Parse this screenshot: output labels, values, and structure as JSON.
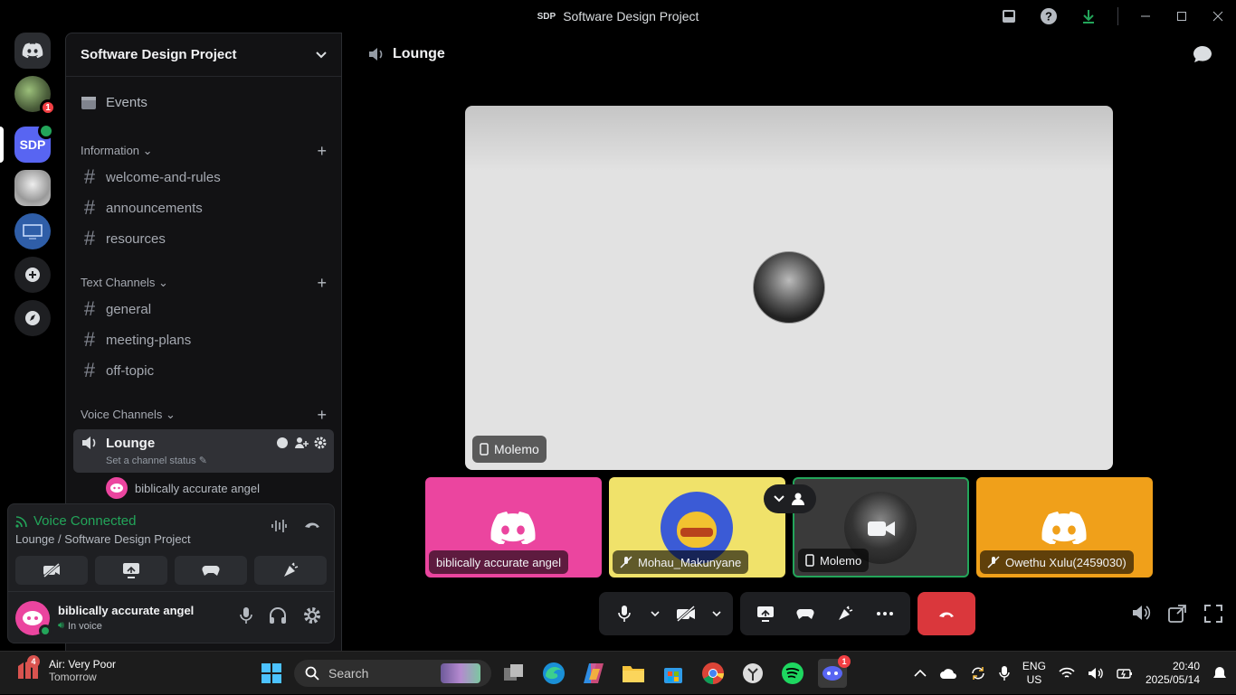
{
  "window": {
    "title": "Software Design Project",
    "badge": "SDP"
  },
  "servers": [
    {
      "name": "dm-home",
      "badge": ""
    },
    {
      "name": "server-1",
      "badge": "1"
    },
    {
      "name": "server-sdp",
      "label": "SDP"
    },
    {
      "name": "server-3"
    },
    {
      "name": "server-4"
    }
  ],
  "guild": {
    "name": "Software Design Project",
    "events_label": "Events",
    "categories": [
      {
        "label": "Information",
        "channels": [
          "welcome-and-rules",
          "announcements",
          "resources"
        ]
      },
      {
        "label": "Text Channels",
        "channels": [
          "general",
          "meeting-plans",
          "off-topic"
        ]
      },
      {
        "label": "Voice Channels"
      }
    ],
    "voice_channel": {
      "name": "Lounge",
      "status_placeholder": "Set a channel status",
      "members": [
        "biblically accurate angel"
      ]
    }
  },
  "voice_panel": {
    "status": "Voice Connected",
    "location": "Lounge / Software Design Project"
  },
  "user": {
    "name": "biblically accurate angel",
    "status": "In voice"
  },
  "main": {
    "channel": "Lounge",
    "stage_name": "Molemo",
    "tiles": [
      {
        "name": "biblically accurate angel",
        "color": "#eb459f"
      },
      {
        "name": "Mohau_Makunyane",
        "color": "#f0e26a"
      },
      {
        "name": "Molemo",
        "color": "#3a3a3a"
      },
      {
        "name": "Owethu Xulu(2459030)",
        "color": "#f0a01a"
      }
    ]
  },
  "taskbar": {
    "weather_badge": "4",
    "weather_line1": "Air: Very Poor",
    "weather_line2": "Tomorrow",
    "search": "Search",
    "lang1": "ENG",
    "lang2": "US",
    "time": "20:40",
    "date": "2025/05/14",
    "discord_badge": "1"
  },
  "colors": {
    "accent": "#5865f2",
    "green": "#23a55a",
    "red": "#da373c"
  }
}
